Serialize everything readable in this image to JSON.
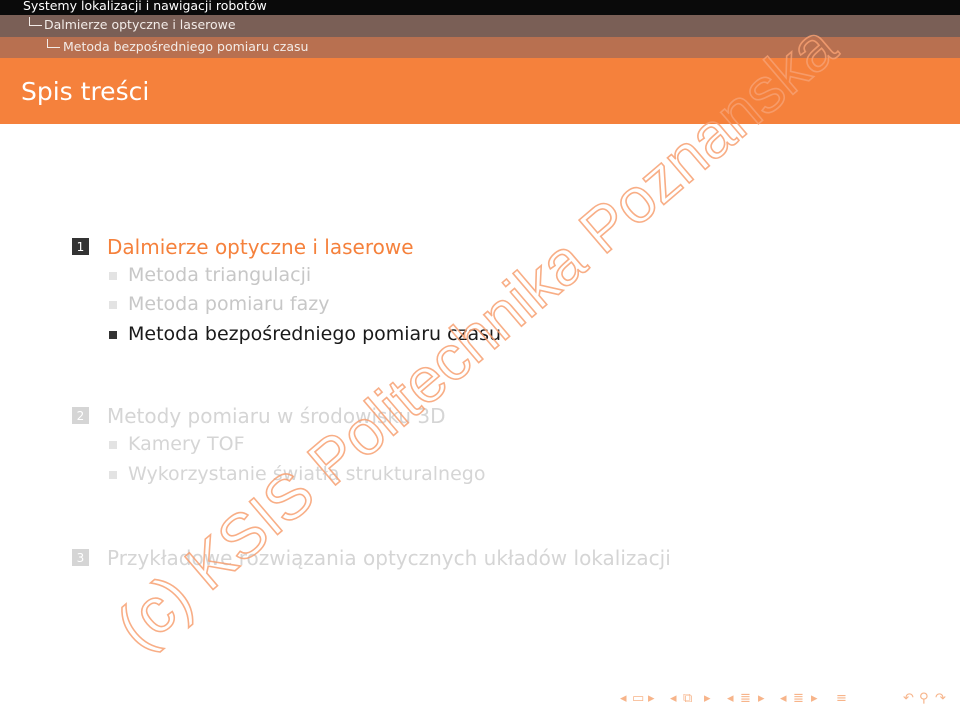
{
  "header": {
    "presentation_title": "Systemy lokalizacji i nawigacji robotów",
    "section": "Dalmierze optyczne i laserowe",
    "subsection": "Metoda bezpośredniego pomiaru czasu"
  },
  "frame": {
    "title": "Spis treści"
  },
  "toc": {
    "sections": [
      {
        "number": "1",
        "label": "Dalmierze optyczne i laserowe",
        "subsections": [
          "Metoda triangulacji",
          "Metoda pomiaru fazy",
          "Metoda bezpośredniego pomiaru czasu"
        ]
      },
      {
        "number": "2",
        "label": "Metody pomiaru w środowisku 3D",
        "subsections": [
          "Kamery TOF",
          "Wykorzystanie światła strukturalnego"
        ]
      },
      {
        "number": "3",
        "label": "Przykładowe rozwiązania optycznych układów lokalizacji",
        "subsections": []
      }
    ]
  },
  "watermark": {
    "text": "(c) KSIS Politechnika Poznanska"
  },
  "colors": {
    "accent": "#f5813c",
    "header_dark": "#0a0a0a",
    "header_brown": "#7a5f56",
    "header_rust": "#b87050",
    "watermark": "#f7a072"
  },
  "navigation": {
    "icons": [
      "nav-left-arrow-icon",
      "nav-frame-icon",
      "nav-right-arrow-icon",
      "nav-left-arrow-icon",
      "nav-subsection-icon",
      "nav-right-arrow-icon",
      "nav-left-arrow-icon",
      "nav-section-icon",
      "nav-right-arrow-icon",
      "nav-left-arrow-icon",
      "nav-section-icon",
      "nav-right-arrow-icon",
      "nav-align-icon",
      "nav-back-icon",
      "nav-search-icon",
      "nav-forward-icon"
    ]
  }
}
